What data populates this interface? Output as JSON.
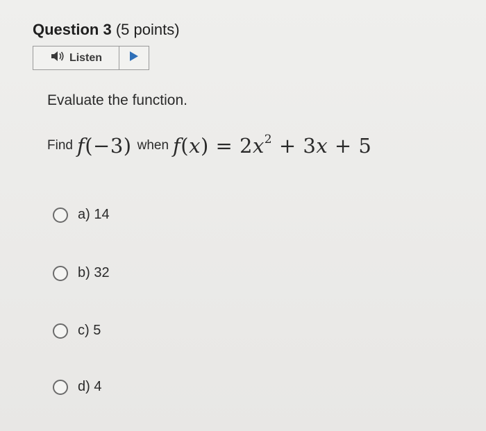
{
  "question": {
    "title_bold": "Question 3",
    "title_points": "(5 points)"
  },
  "listen": {
    "label": "Listen",
    "speaker_icon": "speaker-icon",
    "play_icon": "play-icon"
  },
  "instruction": "Evaluate the function.",
  "prompt": {
    "find": "Find",
    "when": "when",
    "expr_f_arg": "f(−3)",
    "equation_lhs": "f(x)",
    "equation_rhs": "= 2x² + 3x + 5"
  },
  "options": [
    {
      "label": "a)  14"
    },
    {
      "label": "b)  32"
    },
    {
      "label": "c)  5"
    },
    {
      "label": "d)  4"
    }
  ]
}
